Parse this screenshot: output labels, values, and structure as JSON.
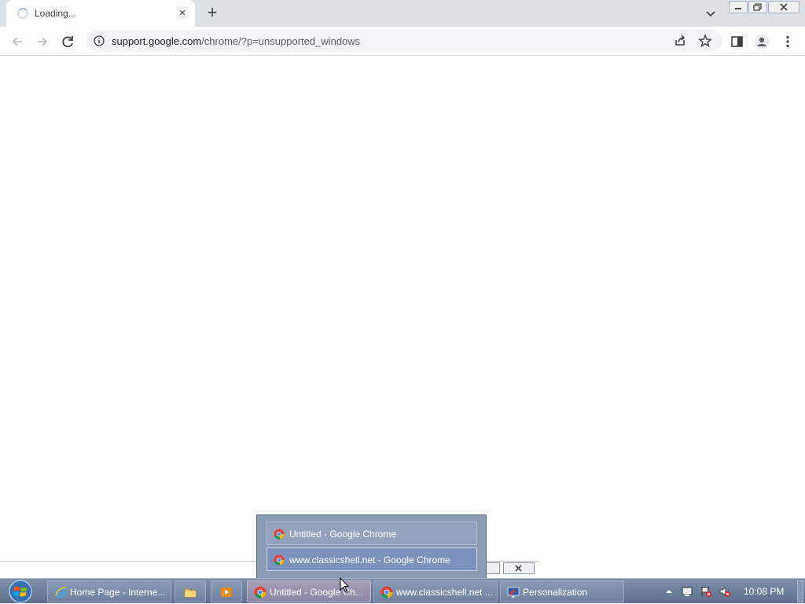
{
  "browser": {
    "tab": {
      "title": "Loading...",
      "close_glyph": "×"
    },
    "new_tab_glyph": "+",
    "address": {
      "host": "support.google.com",
      "path": "/chrome/?p=unsupported_windows"
    }
  },
  "thumbnail_popup": {
    "items": [
      {
        "label": "Untitled - Google Chrome",
        "icon": "chrome-icon"
      },
      {
        "label": "www.classicshell.net - Google Chrome",
        "icon": "chrome-icon"
      }
    ]
  },
  "taskbar": {
    "buttons": [
      {
        "label": "Home Page - Interne...",
        "icon": "internet-explorer-icon"
      },
      {
        "label": "",
        "icon": "folder-icon"
      },
      {
        "label": "",
        "icon": "media-player-icon"
      },
      {
        "label": "Untitled - Google Ch...",
        "icon": "chrome-icon"
      },
      {
        "label": "www.classicshell.net ...",
        "icon": "chrome-icon"
      },
      {
        "label": "Personalization",
        "icon": "personalization-icon"
      }
    ],
    "clock": "10:08 PM"
  }
}
